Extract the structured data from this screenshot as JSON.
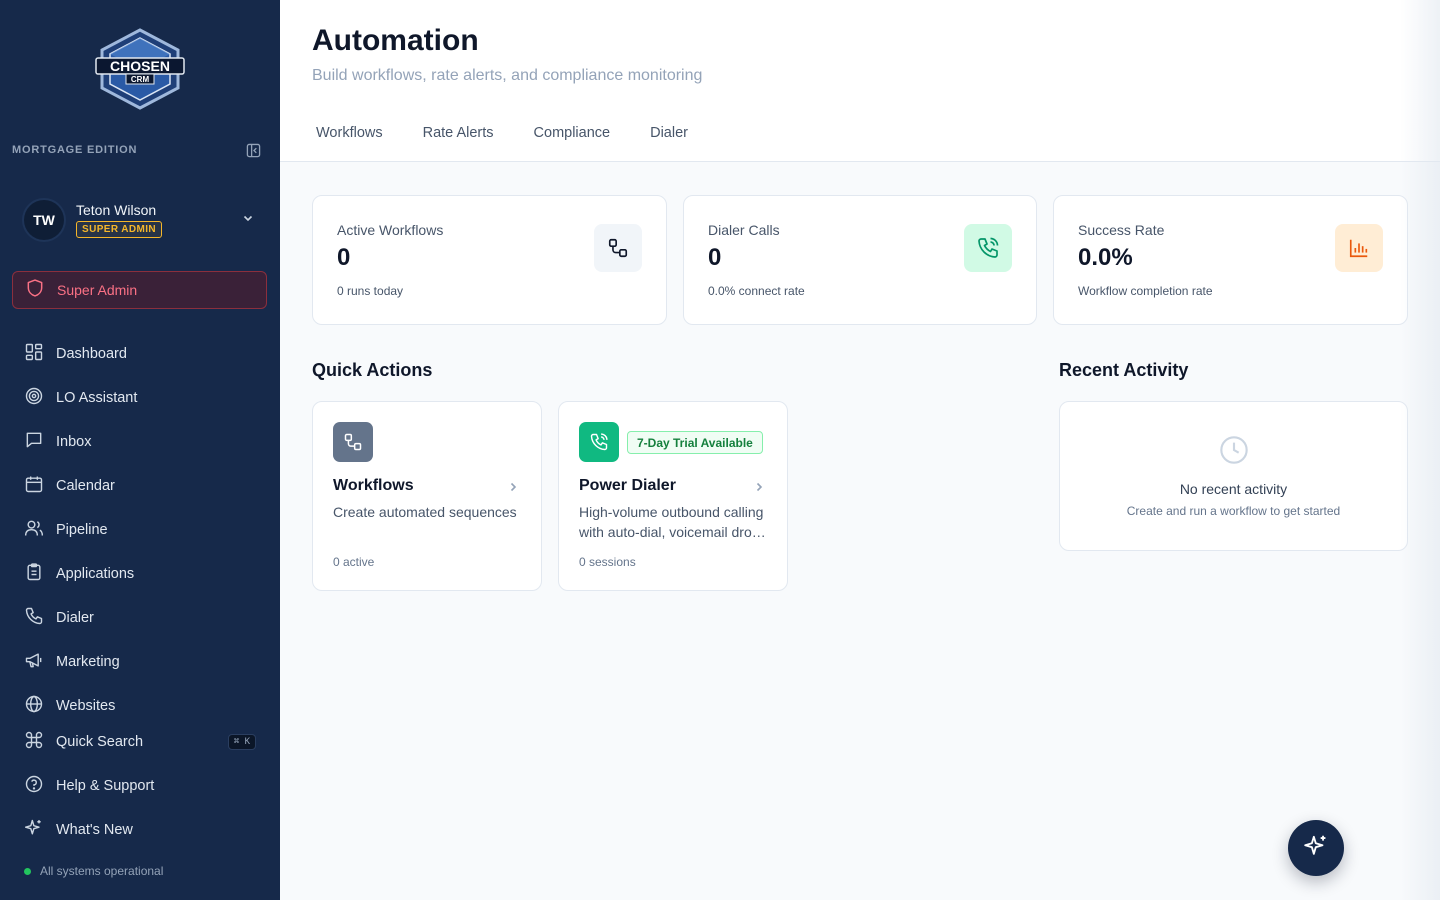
{
  "brand": {
    "logo_text": "CHOSEN",
    "logo_sub": "CRM",
    "edition": "MORTGAGE EDITION"
  },
  "user": {
    "initials": "TW",
    "name": "Teton Wilson",
    "role": "SUPER ADMIN"
  },
  "super_admin_label": "Super Admin",
  "nav": {
    "items": [
      {
        "label": "Dashboard",
        "icon": "dashboard-icon"
      },
      {
        "label": "LO Assistant",
        "icon": "target-icon"
      },
      {
        "label": "Inbox",
        "icon": "message-icon"
      },
      {
        "label": "Calendar",
        "icon": "calendar-icon"
      },
      {
        "label": "Pipeline",
        "icon": "users-icon"
      },
      {
        "label": "Applications",
        "icon": "clipboard-icon"
      },
      {
        "label": "Dialer",
        "icon": "phone-icon"
      },
      {
        "label": "Marketing",
        "icon": "megaphone-icon"
      },
      {
        "label": "Websites",
        "icon": "globe-icon"
      }
    ],
    "bottom": [
      {
        "label": "Quick Search",
        "icon": "command-icon",
        "shortcut": "⌘ K"
      },
      {
        "label": "Help & Support",
        "icon": "help-icon"
      },
      {
        "label": "What's New",
        "icon": "sparkles-icon"
      }
    ]
  },
  "status_text": "All systems operational",
  "header": {
    "title": "Automation",
    "subtitle": "Build workflows, rate alerts, and compliance monitoring",
    "tabs": [
      "Workflows",
      "Rate Alerts",
      "Compliance",
      "Dialer"
    ]
  },
  "stats": [
    {
      "label": "Active Workflows",
      "value": "0",
      "sub": "0 runs today",
      "icon": "workflow-icon",
      "color": "#0f172a"
    },
    {
      "label": "Dialer Calls",
      "value": "0",
      "sub": "0.0% connect rate",
      "icon": "phone-call-icon",
      "color": "#059669"
    },
    {
      "label": "Success Rate",
      "value": "0.0%",
      "sub": "Workflow completion rate",
      "icon": "bar-chart-icon",
      "color": "#ea580c"
    }
  ],
  "quick_actions": {
    "title": "Quick Actions",
    "cards": [
      {
        "title": "Workflows",
        "desc": "Create automated sequences",
        "meta": "0 active",
        "icon": "workflow-icon"
      },
      {
        "title": "Power Dialer",
        "desc": "High-volume outbound calling with auto-dial, voicemail drop and more",
        "meta": "0 sessions",
        "badge": "7-Day Trial Available",
        "icon": "phone-call-icon"
      }
    ]
  },
  "recent_activity": {
    "title": "Recent Activity",
    "empty_title": "No recent activity",
    "empty_sub": "Create and run a workflow to get started"
  },
  "colors": {
    "sidebar": "#16294a",
    "accent_green": "#10b981",
    "accent_red": "#fb7185",
    "accent_gold": "#f5b62a",
    "accent_orange": "#ea580c"
  }
}
